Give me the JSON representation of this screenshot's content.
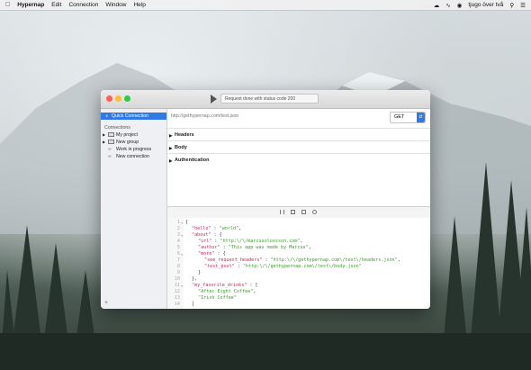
{
  "menubar": {
    "app_name": "Hypernap",
    "items": [
      "Edit",
      "Connection",
      "Window",
      "Help"
    ],
    "clock": "tjugo över två"
  },
  "window": {
    "status_text": "Request done with status code 200"
  },
  "sidebar": {
    "quick_connection": "Quick Connection",
    "connections_heading": "Connections",
    "items": [
      {
        "label": "My project",
        "type": "folder"
      },
      {
        "label": "New group",
        "type": "folder"
      },
      {
        "label": "Work in progress",
        "type": "connection"
      },
      {
        "label": "New connection",
        "type": "connection"
      }
    ],
    "add_label": "+"
  },
  "request": {
    "url_placeholder": "http://gethypernap.com/test.json",
    "method": "GET",
    "sections": [
      "Headers",
      "Body",
      "Authentication"
    ]
  },
  "response": {
    "lines": [
      {
        "n": "1",
        "fold": "▾",
        "indent": 0,
        "parts": [
          [
            "p",
            "{"
          ]
        ]
      },
      {
        "n": "2",
        "fold": "",
        "indent": 1,
        "parts": [
          [
            "k",
            "\"hello\""
          ],
          [
            "p",
            " : "
          ],
          [
            "s",
            "\"world\""
          ],
          [
            "p",
            ","
          ]
        ]
      },
      {
        "n": "3",
        "fold": "▾",
        "indent": 1,
        "parts": [
          [
            "k",
            "\"about\""
          ],
          [
            "p",
            " : {"
          ]
        ]
      },
      {
        "n": "4",
        "fold": "",
        "indent": 2,
        "parts": [
          [
            "k",
            "\"url\""
          ],
          [
            "p",
            " : "
          ],
          [
            "s",
            "\"http:\\/\\/marcusolovsson.com\""
          ],
          [
            "p",
            ","
          ]
        ]
      },
      {
        "n": "5",
        "fold": "",
        "indent": 2,
        "parts": [
          [
            "k",
            "\"author\""
          ],
          [
            "p",
            " : "
          ],
          [
            "s",
            "\"This app was made by Marcus\""
          ],
          [
            "p",
            ","
          ]
        ]
      },
      {
        "n": "6",
        "fold": "▾",
        "indent": 2,
        "parts": [
          [
            "k",
            "\"more\""
          ],
          [
            "p",
            " : {"
          ]
        ]
      },
      {
        "n": "7",
        "fold": "",
        "indent": 3,
        "parts": [
          [
            "k",
            "\"see_request_headers\""
          ],
          [
            "p",
            " : "
          ],
          [
            "s",
            "\"http:\\/\\/gethypernap.com\\/test\\/headers.json\""
          ],
          [
            "p",
            ","
          ]
        ]
      },
      {
        "n": "8",
        "fold": "",
        "indent": 3,
        "parts": [
          [
            "k",
            "\"test_post\""
          ],
          [
            "p",
            " : "
          ],
          [
            "s",
            "\"http:\\/\\/gethypernap.com\\/test\\/body.json\""
          ]
        ]
      },
      {
        "n": "9",
        "fold": "",
        "indent": 2,
        "parts": [
          [
            "p",
            "}"
          ]
        ]
      },
      {
        "n": "10",
        "fold": "",
        "indent": 1,
        "parts": [
          [
            "p",
            "},"
          ]
        ]
      },
      {
        "n": "11",
        "fold": "▾",
        "indent": 1,
        "parts": [
          [
            "k",
            "\"my_favorite_drinks\""
          ],
          [
            "p",
            " : ["
          ]
        ]
      },
      {
        "n": "12",
        "fold": "",
        "indent": 2,
        "parts": [
          [
            "s",
            "\"After Eight Coffee\""
          ],
          [
            "p",
            ","
          ]
        ]
      },
      {
        "n": "13",
        "fold": "",
        "indent": 2,
        "parts": [
          [
            "s",
            "\"Irish Coffee\""
          ]
        ]
      },
      {
        "n": "14",
        "fold": "",
        "indent": 1,
        "parts": [
          [
            "p",
            "]"
          ]
        ]
      }
    ]
  },
  "colors": {
    "accent": "#2f7ae5",
    "json_key": "#d0215f",
    "json_string": "#3c9a2b",
    "close": "#fc605c",
    "minimize": "#fdbc40",
    "zoom": "#34c84a"
  }
}
